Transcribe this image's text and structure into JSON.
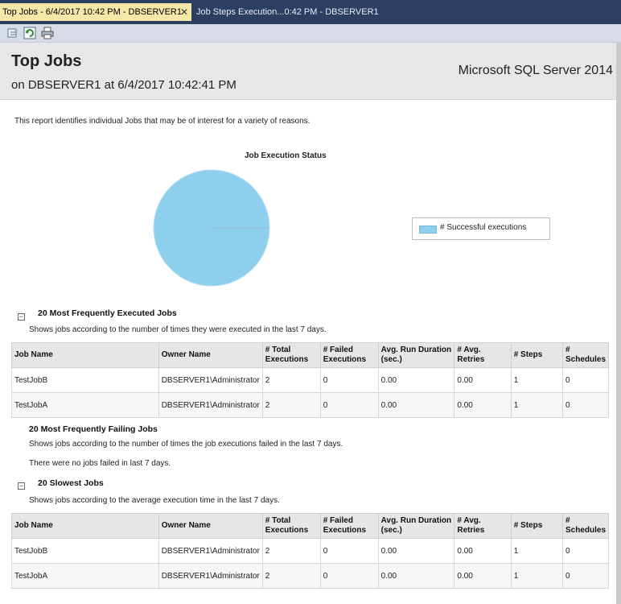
{
  "tabs": [
    {
      "label": "Top Jobs - 6/4/2017 10:42 PM - DBSERVER1",
      "close": "✕"
    },
    {
      "label": "Job Steps Execution...0:42 PM - DBSERVER1"
    }
  ],
  "toolbar": {
    "icons": [
      "print-layout-icon",
      "refresh-icon",
      "print-icon"
    ]
  },
  "header": {
    "title": "Top Jobs",
    "subtitle": "on DBSERVER1 at 6/4/2017 10:42:41 PM",
    "product": "Microsoft SQL Server 2014"
  },
  "description": "This report identifies individual Jobs that may be of interest for a variety of reasons.",
  "chart_data": {
    "type": "pie",
    "title": "Job Execution Status",
    "slices": [
      {
        "label": "# Successful executions",
        "value": 100,
        "color": "#8ecfee"
      }
    ],
    "legend": "right"
  },
  "section1": {
    "title": "20 Most Frequently Executed Jobs",
    "desc": "Shows jobs according to the number of times they were executed in the last 7 days.",
    "toggle": "−"
  },
  "section2": {
    "title": "20 Most Frequently Failing Jobs",
    "desc": "Shows jobs according to the number of times the job executions failed in the last 7 days.",
    "empty": "There were no jobs failed in last 7 days."
  },
  "section3": {
    "title": "20 Slowest Jobs",
    "desc": "Shows jobs according to the average execution time in the last 7 days.",
    "toggle": "−"
  },
  "columns": [
    "Job Name",
    "Owner Name",
    "# Total Executions",
    "# Failed Executions",
    "Avg. Run Duration (sec.)",
    "# Avg. Retries",
    "# Steps",
    "# Schedules"
  ],
  "table1": [
    [
      "TestJobB",
      "DBSERVER1\\Administrator",
      "2",
      "0",
      "0.00",
      "0.00",
      "1",
      "0"
    ],
    [
      "TestJobA",
      "DBSERVER1\\Administrator",
      "2",
      "0",
      "0.00",
      "0.00",
      "1",
      "0"
    ]
  ],
  "table2": [
    [
      "TestJobB",
      "DBSERVER1\\Administrator",
      "2",
      "0",
      "0.00",
      "0.00",
      "1",
      "0"
    ],
    [
      "TestJobA",
      "DBSERVER1\\Administrator",
      "2",
      "0",
      "0.00",
      "0.00",
      "1",
      "0"
    ]
  ]
}
